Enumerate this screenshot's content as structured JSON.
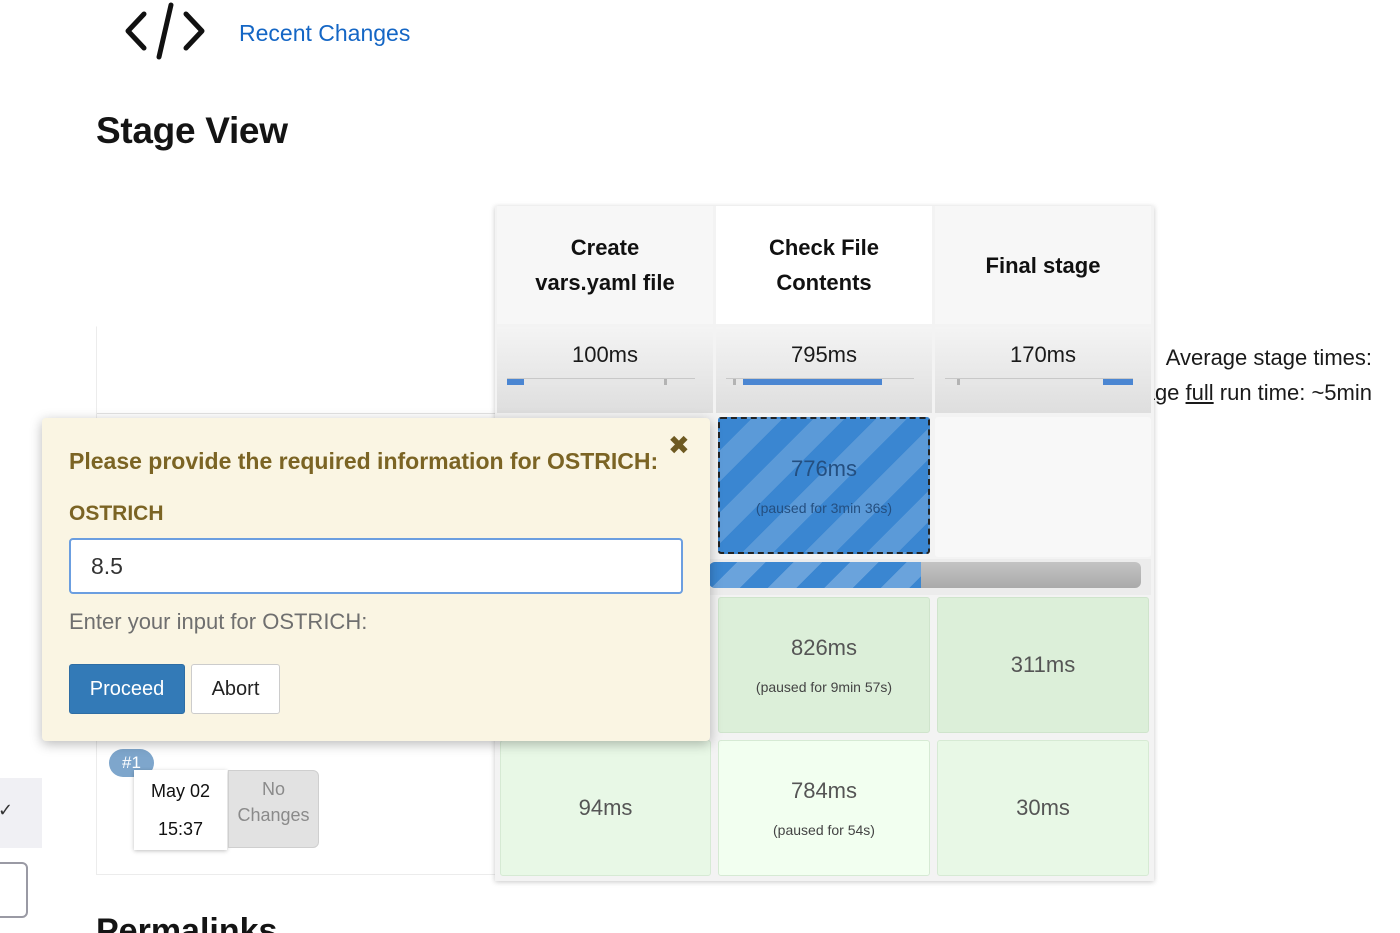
{
  "header": {
    "logo_icon": "code-icon",
    "recent_changes_link": "Recent Changes"
  },
  "page_title": "Stage View",
  "average": {
    "label_line1": "Average stage times:",
    "label_line2_pre": "(Average ",
    "label_line2_link": "full",
    "label_line2_post": " run time: ~5min"
  },
  "stages": [
    {
      "name_line1": "Create",
      "name_line2": "vars.yaml file",
      "avg_time": "100ms",
      "avg_share": 0.09
    },
    {
      "name_line1": "Check File",
      "name_line2": "Contents",
      "avg_time": "795ms",
      "avg_share": 0.74
    },
    {
      "name_line1": "Final stage",
      "name_line2": "",
      "avg_time": "170ms",
      "avg_share": 0.16
    }
  ],
  "runs": {
    "current": {
      "paused_time": "776ms",
      "paused_note": "(paused for 3min 36s)",
      "progress": 0.49
    },
    "run2": {
      "cells": [
        {
          "time": "826ms",
          "note": "(paused for 9min 57s)"
        },
        {
          "time": "311ms",
          "note": ""
        }
      ]
    },
    "run1": {
      "badge": "#1",
      "date": "May 02",
      "time": "15:37",
      "changes_line1": "No",
      "changes_line2": "Changes",
      "cells": [
        {
          "time": "94ms",
          "note": ""
        },
        {
          "time": "784ms",
          "note": "(paused for 54s)"
        },
        {
          "time": "30ms",
          "note": ""
        }
      ]
    }
  },
  "input_popup": {
    "message": "Please provide the required information for OSTRICH:",
    "close_icon": "close-icon",
    "parameter_label": "OSTRICH",
    "value": "8.5",
    "hint": "Enter your input for OSTRICH:",
    "proceed_label": "Proceed",
    "abort_label": "Abort"
  },
  "permalinks_heading": "Permalinks",
  "colors": {
    "accent": "#337ab7",
    "link": "#1466c5",
    "popup_bg": "#faf5e3",
    "popup_text": "#7b6424",
    "success_cell": "#dcefd9"
  }
}
